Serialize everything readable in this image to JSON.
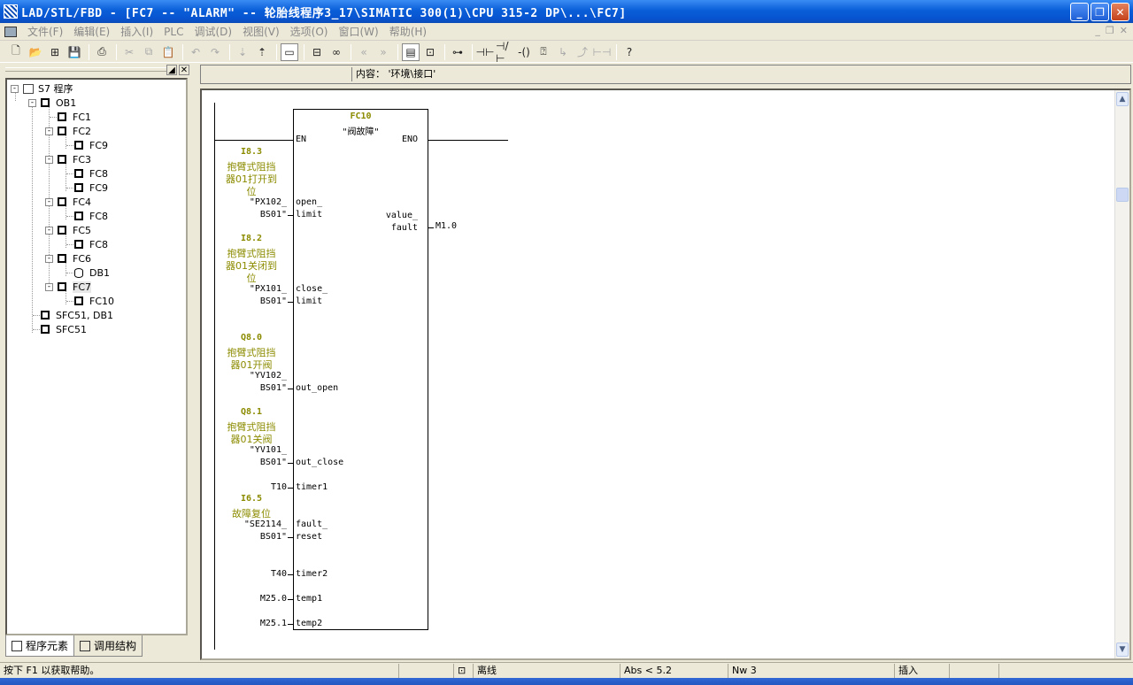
{
  "window": {
    "title": "LAD/STL/FBD  - [FC7 -- \"ALARM\" -- 轮胎线程序3_17\\SIMATIC 300(1)\\CPU 315-2 DP\\...\\FC7]",
    "minimize": "_",
    "restore": "❐",
    "close": "✕"
  },
  "menu": {
    "items": [
      "文件(F)",
      "编辑(E)",
      "插入(I)",
      "PLC",
      "调试(D)",
      "视图(V)",
      "选项(O)",
      "窗口(W)",
      "帮助(H)"
    ],
    "mdi": [
      "_",
      "❐",
      "✕"
    ]
  },
  "toolbar": {
    "icons": [
      "new-icon",
      "open-icon",
      "accessible-nodes-icon",
      "save-icon",
      "print-icon",
      "cut-icon",
      "copy-icon",
      "paste-icon",
      "undo-icon",
      "redo-icon",
      "download-icon",
      "upload-icon",
      "overview-icon",
      "network-icon",
      "monitor-icon",
      "prev-icon",
      "next-icon",
      "program-elements-icon",
      "zoom-icon",
      "box-icon",
      "no-contact-icon",
      "nc-contact-icon",
      "coil-icon",
      "branch-open-icon",
      "branch-close-icon",
      "help-icon"
    ]
  },
  "tree": {
    "root": "S7 程序",
    "nodes": [
      {
        "label": "OB1",
        "type": "block",
        "level": 1,
        "expander": "-"
      },
      {
        "label": "FC1",
        "type": "block",
        "level": 2,
        "expander": ""
      },
      {
        "label": "FC2",
        "type": "block",
        "level": 2,
        "expander": "-"
      },
      {
        "label": "FC9",
        "type": "block",
        "level": 3,
        "expander": ""
      },
      {
        "label": "FC3",
        "type": "block",
        "level": 2,
        "expander": "-"
      },
      {
        "label": "FC8",
        "type": "block",
        "level": 3,
        "expander": ""
      },
      {
        "label": "FC9",
        "type": "block",
        "level": 3,
        "expander": ""
      },
      {
        "label": "FC4",
        "type": "block",
        "level": 2,
        "expander": "-"
      },
      {
        "label": "FC8",
        "type": "block",
        "level": 3,
        "expander": ""
      },
      {
        "label": "FC5",
        "type": "block",
        "level": 2,
        "expander": "-"
      },
      {
        "label": "FC8",
        "type": "block",
        "level": 3,
        "expander": ""
      },
      {
        "label": "FC6",
        "type": "block",
        "level": 2,
        "expander": "-"
      },
      {
        "label": "DB1",
        "type": "db",
        "level": 3,
        "expander": ""
      },
      {
        "label": "FC7",
        "type": "block",
        "level": 2,
        "expander": "-",
        "selected": true
      },
      {
        "label": "FC10",
        "type": "block",
        "level": 3,
        "expander": ""
      },
      {
        "label": "SFC51, DB1",
        "type": "block",
        "level": 1,
        "expander": ""
      },
      {
        "label": "SFC51",
        "type": "block",
        "level": 1,
        "expander": ""
      }
    ],
    "tabs": [
      "程序元素",
      "调用结构"
    ]
  },
  "content_bar": {
    "text": "内容： '环境\\接口'"
  },
  "network": {
    "block_number": "FC10",
    "block_symbol": "\"阀故障\"",
    "en": "EN",
    "eno": "ENO",
    "inputs": [
      {
        "addr": "I8.3",
        "comment": [
          "抱臂式阻挡",
          "器01打开到",
          "位"
        ],
        "symbol": [
          "\"PX102_",
          "BS01\""
        ],
        "pin": [
          "open_",
          "limit"
        ]
      },
      {
        "addr": "I8.2",
        "comment": [
          "抱臂式阻挡",
          "器01关闭到",
          "位"
        ],
        "symbol": [
          "\"PX101_",
          "BS01\""
        ],
        "pin": [
          "close_",
          "limit"
        ]
      },
      {
        "addr": "Q8.0",
        "comment": [
          "抱臂式阻挡",
          "器01开阀"
        ],
        "symbol": [
          "\"YV102_",
          "BS01\""
        ],
        "pin": [
          "out_open"
        ]
      },
      {
        "addr": "Q8.1",
        "comment": [
          "抱臂式阻挡",
          "器01关阀"
        ],
        "symbol": [
          "\"YV101_",
          "BS01\""
        ],
        "pin": [
          "out_close"
        ]
      },
      {
        "addr": "",
        "comment": [],
        "symbol": [
          "T10"
        ],
        "pin": [
          "timer1"
        ]
      },
      {
        "addr": "I6.5",
        "comment": [
          "故障复位"
        ],
        "symbol": [
          "\"SE2114_",
          "BS01\""
        ],
        "pin": [
          "fault_",
          "reset"
        ]
      },
      {
        "addr": "",
        "comment": [],
        "symbol": [
          "T40"
        ],
        "pin": [
          "timer2"
        ]
      },
      {
        "addr": "",
        "comment": [],
        "symbol": [
          "M25.0"
        ],
        "pin": [
          "temp1"
        ]
      },
      {
        "addr": "",
        "comment": [],
        "symbol": [
          "M25.1"
        ],
        "pin": [
          "temp2"
        ]
      }
    ],
    "output": {
      "pin": [
        "value_",
        "fault"
      ],
      "operand": "M1.0"
    }
  },
  "statusbar": {
    "help": "按下 F1 以获取帮助。",
    "mode": "离线",
    "pos": "Abs < 5.2",
    "nw": "Nw 3",
    "ins": "插入"
  },
  "colors": {
    "address": "#8b8b00",
    "title_bar": "#0a5ed8"
  }
}
